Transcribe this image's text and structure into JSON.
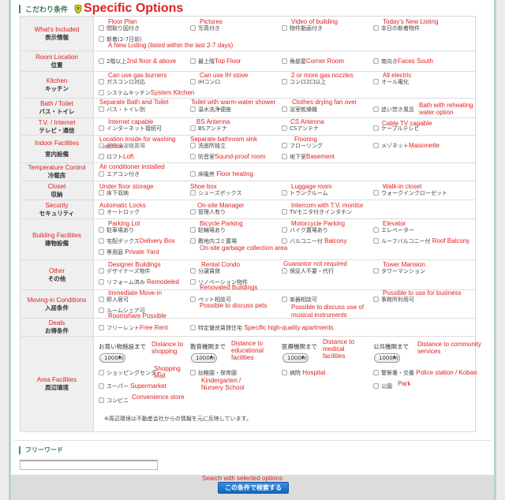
{
  "header": {
    "section_jp": "こだわり条件",
    "section_en": "Specific Options",
    "shield_icon": "shield-icon"
  },
  "colors": {
    "accent_green": "#3e9a5f",
    "translation_red": "#e02020",
    "button_blue": "#1a6fc8",
    "label_bg": "#efefef"
  },
  "rows": [
    {
      "label_en": "What's Included",
      "label_jp": "表示情報",
      "items": [
        {
          "jp": "間取り図付き",
          "en": "Floor Plan"
        },
        {
          "jp": "写真付き",
          "en": "Pictures"
        },
        {
          "jp": "物件動画付き",
          "en": "Video of building"
        },
        {
          "jp": "本日の新着物件",
          "en": "Today's New Listing"
        },
        {
          "jp": "新着(2-7日前)",
          "en": "A New Listing (listed within the last 2-7 days)"
        }
      ]
    },
    {
      "label_en": "Room Location",
      "label_jp": "位置",
      "items": [
        {
          "jp": "2階以上",
          "en": "2nd floor & above"
        },
        {
          "jp": "最上階",
          "en": "Top Floor"
        },
        {
          "jp": "角部屋",
          "en": "Corner Room"
        },
        {
          "jp": "南向き",
          "en": "Faces South"
        }
      ]
    },
    {
      "label_en": "Kitchen",
      "label_jp": "キッチン",
      "items": [
        {
          "jp": "ガスコンロ対応",
          "en": "Can use gas burners"
        },
        {
          "jp": "IHコンロ",
          "en": "Can use IH stove"
        },
        {
          "jp": "コンロ2口以上",
          "en": "2 or more gas nozzles"
        },
        {
          "jp": "オール電化",
          "en": "All electric"
        },
        {
          "jp": "システムキッチン",
          "en": "System Kitchen"
        }
      ]
    },
    {
      "label_en": "Bath / Toilet",
      "label_jp": "バス・トイレ",
      "items": [
        {
          "jp": "バス・トイレ別",
          "en": "Separate Bath and Toilet"
        },
        {
          "jp": "温水洗浄便座",
          "en": "Toilet with warm-water shower"
        },
        {
          "jp": "浴室乾燥機",
          "en": "Clothes drying fan over"
        },
        {
          "jp": "追い焚き風呂",
          "en": "Bath with reheating water option"
        }
      ]
    },
    {
      "label_en": "T.V. / Internet",
      "label_jp": "テレビ・通信",
      "items": [
        {
          "jp": "インターネット接続可",
          "en": "Internet capable"
        },
        {
          "jp": "BSアンテナ",
          "en": "BS Antenna"
        },
        {
          "jp": "CSアンテナ",
          "en": "CS Antenna"
        },
        {
          "jp": "ケーブルテレビ",
          "en": "Cable TV capable"
        }
      ]
    },
    {
      "label_en": "Indoor Facilities",
      "label_jp": "室内設備",
      "items": [
        {
          "jp": "室内洗濯機置場",
          "en": "Location inside for washing machine"
        },
        {
          "jp": "洗面所独立",
          "en": "Separate bathroom sink"
        },
        {
          "jp": "フローリング",
          "en": "Flooring"
        },
        {
          "jp": "メゾネット",
          "en": "Maisonette"
        },
        {
          "jp": "ロフト",
          "en": "Loft"
        },
        {
          "jp": "防音室",
          "en": "Sound-proof room"
        },
        {
          "jp": "地下室",
          "en": "Basement"
        }
      ]
    },
    {
      "label_en": "Temperature Control",
      "label_jp": "冷暖房",
      "items": [
        {
          "jp": "エアコン付き",
          "en": "Air conditioner installed"
        },
        {
          "jp": "床暖房",
          "en": "Floor heating"
        }
      ]
    },
    {
      "label_en": "Closet",
      "label_jp": "収納",
      "items": [
        {
          "jp": "床下収納",
          "en": "Under floor storage"
        },
        {
          "jp": "シューズボックス",
          "en": "Shoe box"
        },
        {
          "jp": "トランクルーム",
          "en": "Luggage room"
        },
        {
          "jp": "ウォークインクローゼット",
          "en": "Walk-in closet"
        }
      ]
    },
    {
      "label_en": "Security",
      "label_jp": "セキュリティ",
      "items": [
        {
          "jp": "オートロック",
          "en": "Automatic Locks"
        },
        {
          "jp": "管理人有り",
          "en": "On-site Manager"
        },
        {
          "jp": "TVモニタ付きインタホン",
          "en": "Intercom with T.V. monitor"
        }
      ]
    },
    {
      "label_en": "Building Facilities",
      "label_jp": "建物設備",
      "items": [
        {
          "jp": "駐車場あり",
          "en": "Parking Lot"
        },
        {
          "jp": "駐輪場あり",
          "en": "Bicycle Parking"
        },
        {
          "jp": "バイク置場あり",
          "en": "Motorcycle Parking"
        },
        {
          "jp": "エレベーター",
          "en": "Elevator"
        },
        {
          "jp": "宅配ボックス",
          "en": "Delivery Box"
        },
        {
          "jp": "敷地内ゴミ置場",
          "en": "On-site garbage collection area"
        },
        {
          "jp": "バルコニー付",
          "en": "Balcony"
        },
        {
          "jp": "ルーフバルコニー付",
          "en": "Roof Balcony"
        },
        {
          "jp": "専用庭",
          "en": "Private Yard"
        }
      ]
    },
    {
      "label_en": "Other",
      "label_jp": "その他",
      "items": [
        {
          "jp": "デザイナーズ物件",
          "en": "Designer Buildings"
        },
        {
          "jp": "分譲賃貸",
          "en": "Rental Condo"
        },
        {
          "jp": "保証人不要・代行",
          "en": "Guarantor not required"
        },
        {
          "jp": "タワーマンション",
          "en": "Tower Mansion"
        },
        {
          "jp": "リフォーム済み",
          "en": "Remodeled"
        },
        {
          "jp": "リノベーション物件",
          "en": "Renovated Buildings"
        }
      ]
    },
    {
      "label_en": "Moving-in Conditions",
      "label_jp": "入居条件",
      "items": [
        {
          "jp": "即入居可",
          "en": "Immediate Move-in"
        },
        {
          "jp": "ペット相談可",
          "en": "Possible to discuss pets"
        },
        {
          "jp": "楽器相談可",
          "en": "Possible to discuss use of musical instruments"
        },
        {
          "jp": "事務所利用可",
          "en": "Possible to use for business"
        },
        {
          "jp": "ルームシェア可",
          "en": "Roomshare Possible"
        }
      ]
    },
    {
      "label_en": "Deals",
      "label_jp": "お得条件",
      "items": [
        {
          "jp": "フリーレント",
          "en": "Free Rent"
        },
        {
          "jp": "特定優良賃貸住宅",
          "en": "Specific high-quality apartments"
        }
      ]
    },
    {
      "label_en": "Area Facilities",
      "label_jp": "周辺環境",
      "distances": [
        {
          "jp": "お買い物施設まで",
          "en": "Distance to shopping",
          "value": "1000m"
        },
        {
          "jp": "教育機関まで",
          "en": "Distance to educational facilities",
          "value": "1000m"
        },
        {
          "jp": "医療機関まで",
          "en": "Distance to medical facilities",
          "value": "1000m"
        },
        {
          "jp": "公共機関まで",
          "en": "Distance to community services",
          "value": "1000m"
        }
      ],
      "items": [
        {
          "jp": "ショッピングセンター",
          "en": "Shopping Mall"
        },
        {
          "jp": "幼稚園・保育園",
          "en": "Kindergarten / Nursery School"
        },
        {
          "jp": "病院",
          "en": "Hospital"
        },
        {
          "jp": "警察署・交番",
          "en": "Police station / Koban"
        },
        {
          "jp": "スーパー",
          "en": "Supermarket"
        },
        {
          "jp": "公園",
          "en": "Park"
        },
        {
          "jp": "コンビニ",
          "en": "Convenience store"
        }
      ],
      "note": "※周辺環境は不動産会社からの情報を元に反映しています。"
    }
  ],
  "free_word": {
    "label": "フリーワード",
    "value": "",
    "placeholder": ""
  },
  "search": {
    "translation": "Search with selected options",
    "button_label": "この条件で検索する"
  }
}
